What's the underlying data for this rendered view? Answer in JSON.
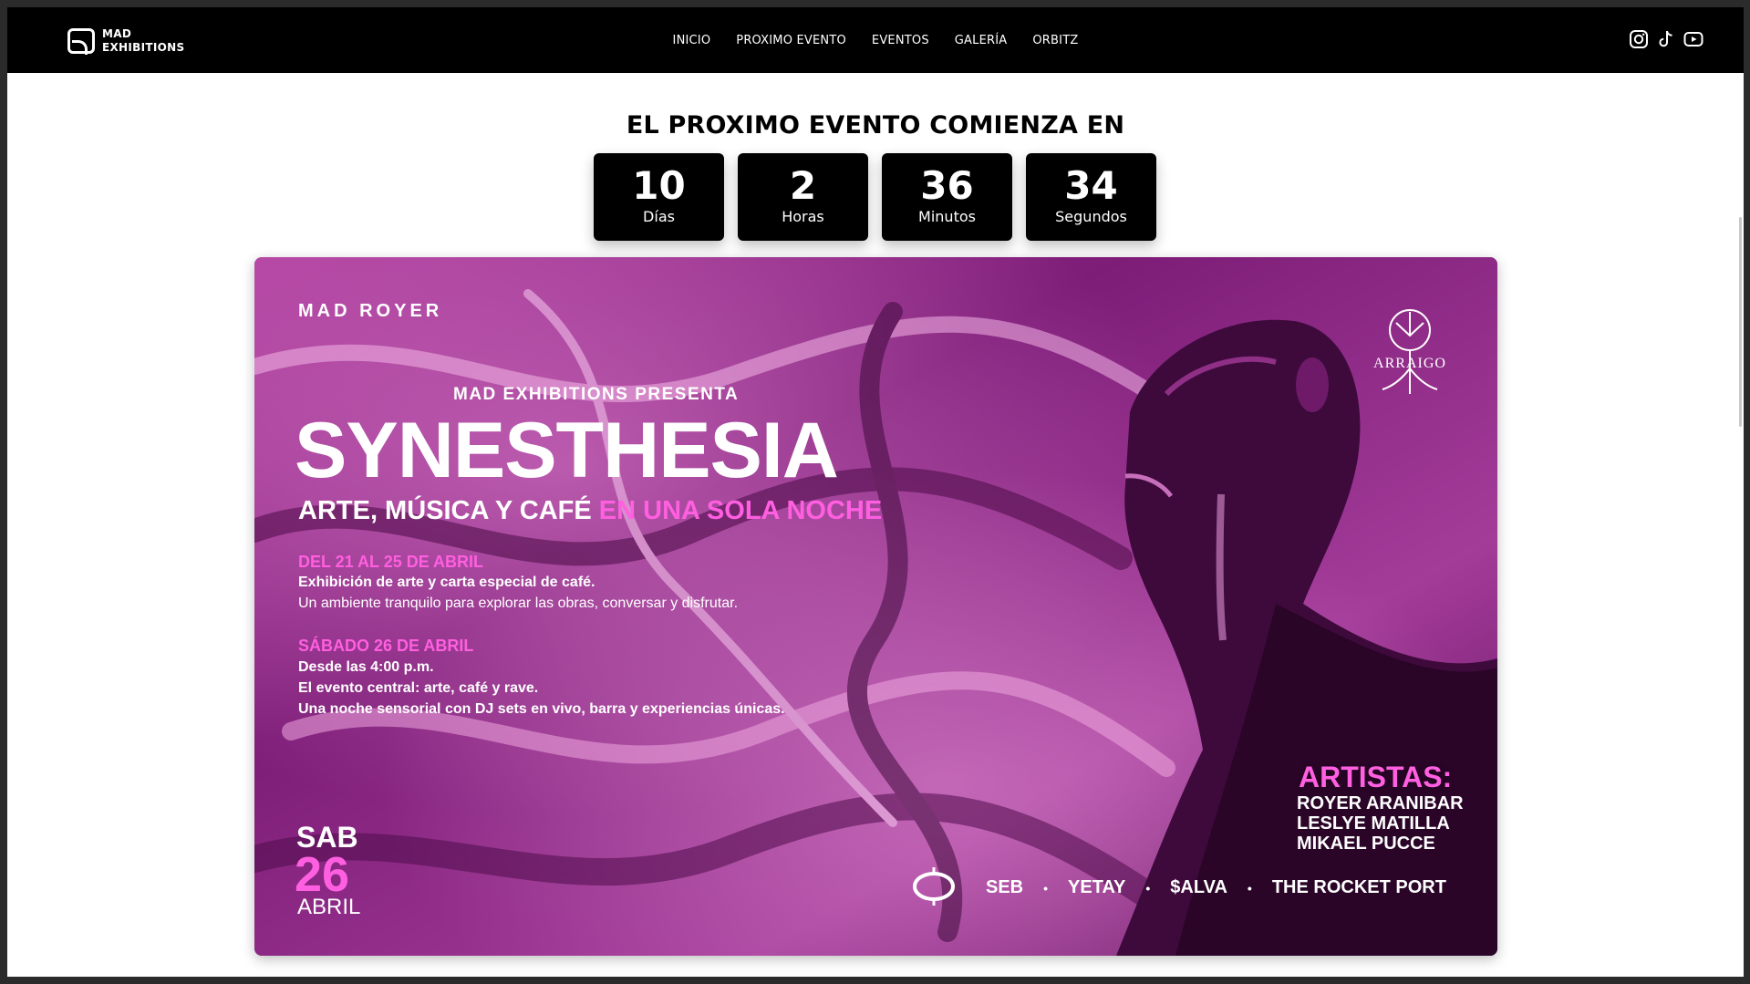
{
  "brand": {
    "line1": "MAD",
    "line2": "EXHIBITIONS"
  },
  "nav": {
    "items": [
      "INICIO",
      "PROXIMO EVENTO",
      "EVENTOS",
      "GALERÍA",
      "ORBITZ"
    ]
  },
  "social": {
    "icons": [
      "instagram-icon",
      "tiktok-icon",
      "youtube-icon"
    ]
  },
  "countdown": {
    "title": "EL PROXIMO EVENTO COMIENZA EN",
    "units": [
      {
        "value": "10",
        "label": "Días"
      },
      {
        "value": "2",
        "label": "Horas"
      },
      {
        "value": "36",
        "label": "Minutos"
      },
      {
        "value": "34",
        "label": "Segundos"
      }
    ]
  },
  "poster": {
    "top_logo": "MAD ROYER",
    "partner_logo": "ARRAIGO",
    "presents": "MAD EXHIBITIONS PRESENTA",
    "title": "SYNESTHESIA",
    "subtitle_white": "ARTE, MÚSICA Y CAFÉ",
    "subtitle_pink": "EN UNA SOLA NOCHE",
    "block1_heading": "DEL 21 AL 25 DE ABRIL",
    "block1_line1": "Exhibición de arte y carta especial de café.",
    "block1_line2": "Un ambiente tranquilo para explorar las obras, conversar y disfrutar.",
    "block2_heading": "SÁBADO 26 DE ABRIL",
    "block2_line1": "Desde las 4:00 p.m.",
    "block2_line2": "El evento central: arte, café y rave.",
    "block2_line3": "Una noche sensorial con DJ sets en vivo, barra y experiencias únicas.",
    "date_day": "SAB",
    "date_num": "26",
    "date_month": "ABRIL",
    "artists_heading": "ARTISTAS:",
    "artists": [
      "ROYER ARANIBAR",
      "LESLYE MATILLA",
      "MIKAEL PUCCE"
    ],
    "djs": [
      "SEB",
      "YETAY",
      "$ALVA",
      "THE ROCKET PORT"
    ]
  }
}
